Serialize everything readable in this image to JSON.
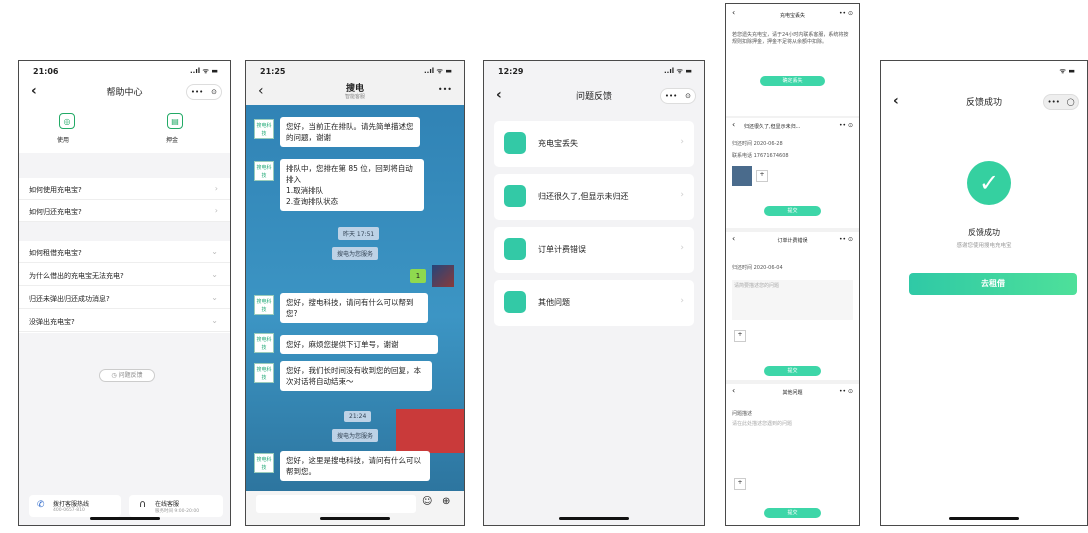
{
  "p1": {
    "time": "21:06",
    "status": "..ıl ᯤ ▬",
    "title": "帮助中心",
    "use": "使用",
    "deposit": "押金",
    "q": [
      "如何使用充电宝?",
      "如何归还充电宝?",
      "如何租借充电宝?",
      "为什么借出的充电宝无法充电?",
      "归还未弹出归还成功消息?",
      "没弹出充电宝?"
    ],
    "feedback": "问题反馈",
    "hotline": "拨打客服热线",
    "hotline_sub": "400-0657-810",
    "online": "在线客服",
    "online_sub": "服务时间 9:00-20:00"
  },
  "p2": {
    "time": "21:25",
    "title": "搜电",
    "subtitle": "智能客服",
    "m1": "您好，当前正在排队。请先简单描述您的问题，谢谢",
    "m2": "排队中，您排在第 85 位，回到将自动排入\n1.取消排队\n2.查询排队状态",
    "t1": "昨天 17:51",
    "s1": "搜电为您服务",
    "me": "1",
    "m3": "您好，搜电科技，请问有什么可以帮到您?",
    "m4": "您好，麻烦您提供下订单号，谢谢",
    "m5": "您好，我们长时间没有收到您的回复，本次对话将自动结束～",
    "t2": "21:24",
    "s2": "搜电为您服务",
    "m6": "您好，这里是搜电科技，请问有什么可以帮到您。",
    "avatar": "搜电科技"
  },
  "p3": {
    "time": "12:29",
    "title": "问题反馈",
    "items": [
      "充电宝丢失",
      "归还很久了,但显示未归还",
      "订单计费错误",
      "其他问题"
    ]
  },
  "p4": {
    "h1": "充电宝丢失",
    "txt": "若您遗失充电宝，请于24小时内联系客服，系统将按规则扣除押金，押金不足将从余额中扣除。",
    "b1": "确定丢失",
    "h2": "归还很久了,但显示未归...",
    "l1": "归还时间",
    "v1": "2020-06-28",
    "l2": "联系电话",
    "v2": "17671674608",
    "b2": "提交",
    "h3": "订单计费错误",
    "l3": "归还时间",
    "v3": "2020-06-04",
    "ph3": "请简要描述您的问题",
    "b3": "提交",
    "h4": "其他问题",
    "l4": "问题描述",
    "ph4": "请在此处描述您遇到的问题",
    "b4": "提交"
  },
  "p5": {
    "title": "反馈成功",
    "main": "反馈成功",
    "sub": "感谢您使用搜电充电宝",
    "btn": "去租借"
  }
}
